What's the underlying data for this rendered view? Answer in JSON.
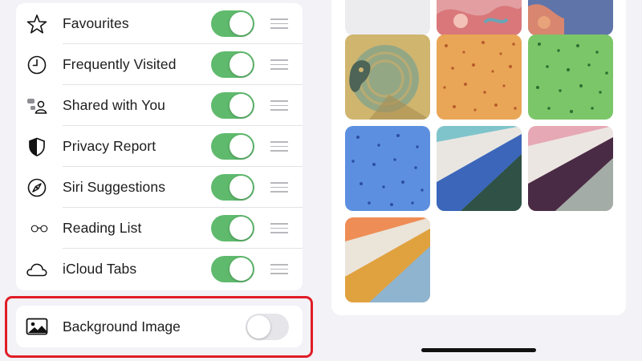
{
  "settings_list": {
    "items": [
      {
        "label": "Favourites",
        "icon": "star-icon",
        "enabled": true
      },
      {
        "label": "Frequently Visited",
        "icon": "clock-icon",
        "enabled": true
      },
      {
        "label": "Shared with You",
        "icon": "shared-people-icon",
        "enabled": true
      },
      {
        "label": "Privacy Report",
        "icon": "shield-icon",
        "enabled": true
      },
      {
        "label": "Siri Suggestions",
        "icon": "compass-icon",
        "enabled": true
      },
      {
        "label": "Reading List",
        "icon": "glasses-icon",
        "enabled": true
      },
      {
        "label": "iCloud Tabs",
        "icon": "cloud-icon",
        "enabled": true
      }
    ]
  },
  "background_image": {
    "label": "Background Image",
    "icon": "photo-icon",
    "enabled": false
  },
  "wallpapers": {
    "count": 10,
    "items": [
      "light-gray",
      "pink-pattern",
      "blue-pink-pattern",
      "parrot",
      "orange-pattern",
      "green-pattern",
      "blue-pattern",
      "blue-teal-diagonal",
      "pink-plum-diagonal",
      "orange-gold-diagonal"
    ]
  },
  "colors": {
    "toggle_on": "#5fba6d",
    "toggle_off": "#e5e5ea",
    "highlight": "#e01d26",
    "background": "#f2f2f7"
  }
}
